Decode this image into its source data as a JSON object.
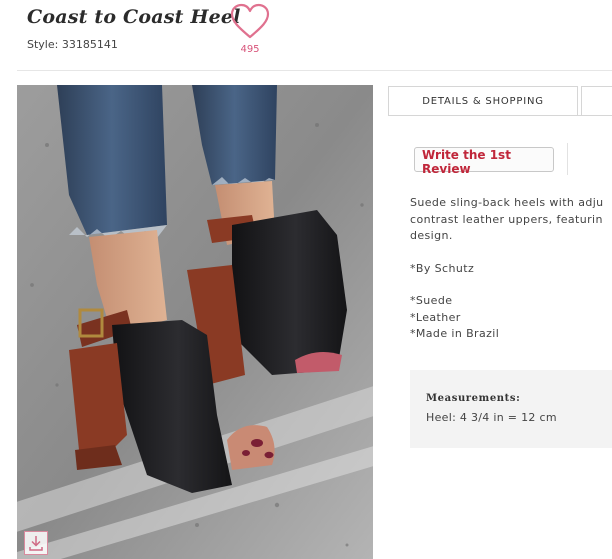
{
  "product": {
    "title": "Coast to Coast Heel",
    "style_label": "Style: 33185141",
    "favorites_count": "495"
  },
  "tabs": [
    {
      "label": "DETAILS & SHOPPING",
      "active": true
    },
    {
      "label": "",
      "active": false
    }
  ],
  "review": {
    "button_label": "Write the 1st Review"
  },
  "description": {
    "lines": [
      "Suede sling-back heels with adju",
      "contrast leather uppers, featurin",
      "design."
    ],
    "brand": "*By Schutz",
    "materials": [
      "*Suede",
      "*Leather",
      "*Made in Brazil"
    ]
  },
  "measurements": {
    "title": "Measurements:",
    "heel": "Heel: 4 3/4 in = 12 cm"
  },
  "icons": {
    "heart": "heart-outline-icon",
    "download": "download-icon"
  },
  "colors": {
    "accent_pink": "#e0718f",
    "review_red": "#c0263a",
    "heel_brown": "#8a3a24",
    "shoe_black": "#1c1c1e"
  }
}
